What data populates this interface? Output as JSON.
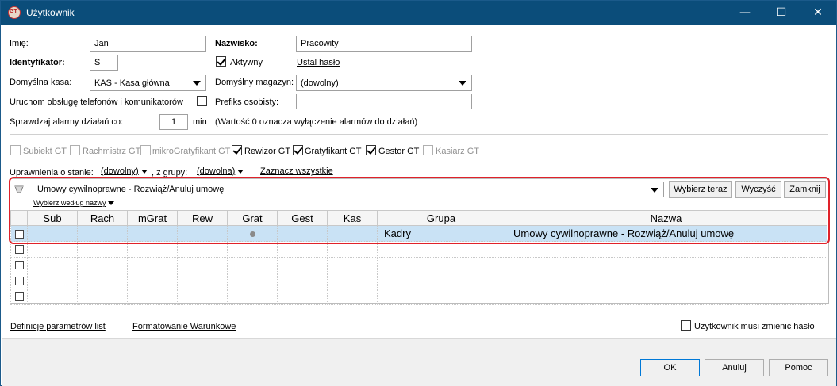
{
  "window": {
    "title": "Użytkownik",
    "minimize": "—",
    "maximize": "☐",
    "close": "✕"
  },
  "form": {
    "imie_label": "Imię:",
    "imie_value": "Jan",
    "nazwisko_label": "Nazwisko:",
    "nazwisko_value": "Pracowity",
    "identyfikator_label": "Identyfikator:",
    "identyfikator_value": "S",
    "aktywny_label": "Aktywny",
    "aktywny_checked": true,
    "ustal_haslo": "Ustal hasło",
    "kasa_label": "Domyślna kasa:",
    "kasa_value": "KAS - Kasa główna",
    "magazyn_label": "Domyślny magazyn:",
    "magazyn_value": "(dowolny)",
    "telefony_label": "Uruchom obsługę telefonów i komunikatorów",
    "prefiks_label": "Prefiks osobisty:",
    "prefiks_value": "",
    "alarmy_label": "Sprawdzaj alarmy działań co:",
    "alarmy_value": "1",
    "alarmy_unit": "min",
    "alarmy_note": "(Wartość 0 oznacza wyłączenie alarmów do działań)"
  },
  "modules": [
    {
      "label": "Subiekt GT",
      "checked": false,
      "enabled": false
    },
    {
      "label": "Rachmistrz GT",
      "checked": false,
      "enabled": false
    },
    {
      "label": "mikroGratyfikant GT",
      "checked": false,
      "enabled": false
    },
    {
      "label": "Rewizor GT",
      "checked": true,
      "enabled": true
    },
    {
      "label": "Gratyfikant GT",
      "checked": true,
      "enabled": true
    },
    {
      "label": "Gestor GT",
      "checked": true,
      "enabled": true
    },
    {
      "label": "Kasiarz GT",
      "checked": false,
      "enabled": false
    }
  ],
  "permissions": {
    "stan_label": "Uprawnienia o stanie:",
    "stan_value": "(dowolny)",
    "grupa_label": ", z grupy:",
    "grupa_value": "(dowolna)",
    "zaznacz": "Zaznacz wszystkie",
    "search_value": "Umowy cywilnoprawne - Rozwiąż/Anuluj umowę",
    "wybierz_teraz": "Wybierz teraz",
    "wyczysc": "Wyczyść",
    "zamknij": "Zamknij",
    "wybierz_wedlug": "Wybierz według nazwy"
  },
  "grid": {
    "columns": [
      "Sub",
      "Rach",
      "mGrat",
      "Rew",
      "Grat",
      "Gest",
      "Kas",
      "Grupa",
      "Nazwa"
    ],
    "rows": [
      {
        "grupa": "Kadry",
        "nazwa": "Umowy cywilnoprawne - Rozwiąż/Anuluj umowę"
      }
    ]
  },
  "bottom": {
    "definicje": "Definicje parametrów list",
    "formatowanie": "Formatowanie Warunkowe",
    "zmiana_hasla": "Użytkownik musi zmienić hasło",
    "ok": "OK",
    "anuluj": "Anuluj",
    "pomoc": "Pomoc"
  }
}
